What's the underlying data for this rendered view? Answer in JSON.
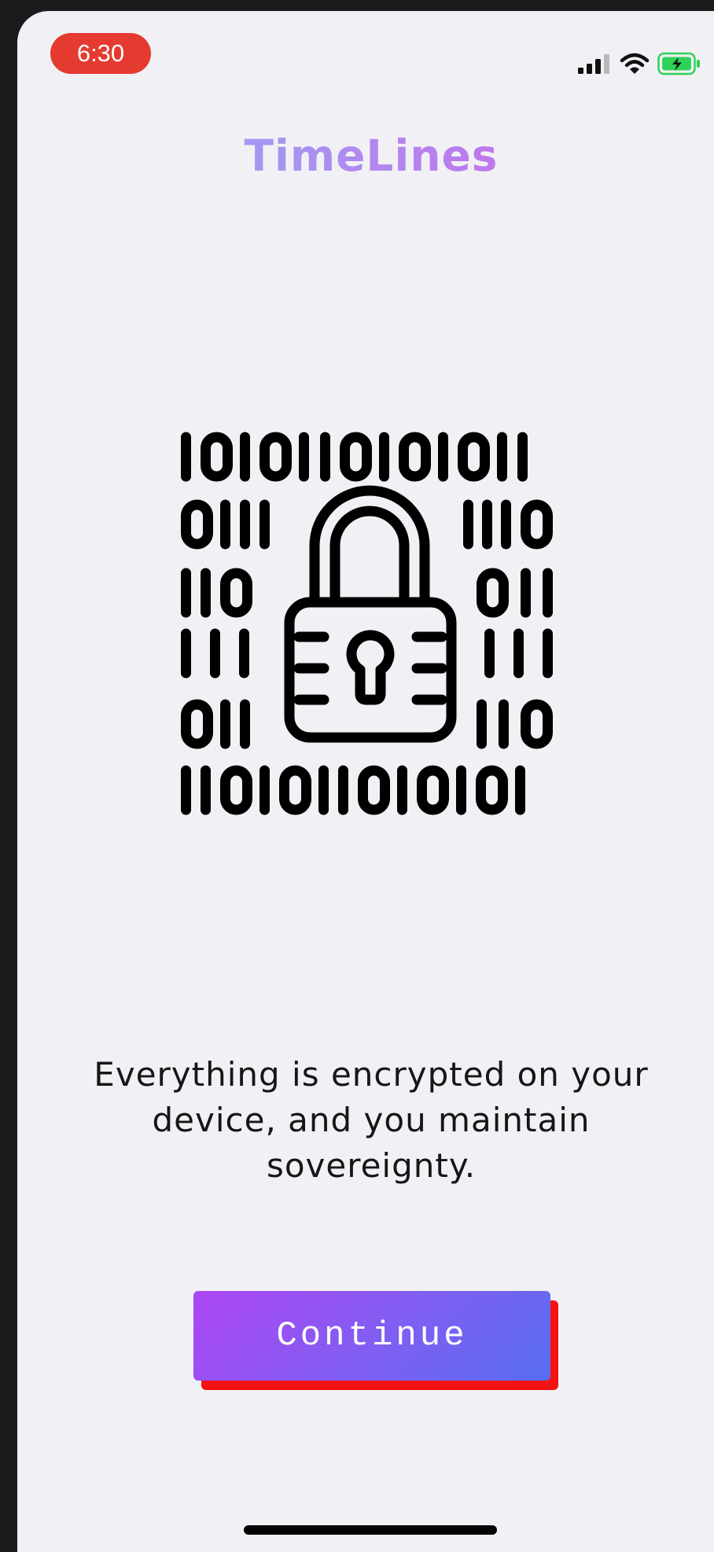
{
  "status_bar": {
    "time": "6:30",
    "icons": [
      "signal-icon",
      "wifi-icon",
      "battery-charging-icon"
    ],
    "pill_color": "#e53a30",
    "battery_color": "#30d158"
  },
  "app": {
    "title": "TimeLines",
    "title_gradient": [
      "#8ab8f6",
      "#b583ee",
      "#d658ec"
    ]
  },
  "illustration": {
    "name": "binary-lock-icon",
    "binary_rows": {
      "top": "1010110101011",
      "bottom": "1101011010101",
      "left": [
        "0111",
        "110",
        "111",
        "011"
      ],
      "right": [
        "1110",
        "011",
        "111",
        "110"
      ]
    }
  },
  "message": {
    "text": "Everything is encrypted on your device, and you maintain sovereignty."
  },
  "continue_button": {
    "label": "Continue",
    "gradient": [
      "#ad46f4",
      "#576df0"
    ],
    "shadow_color": "#f31313"
  }
}
